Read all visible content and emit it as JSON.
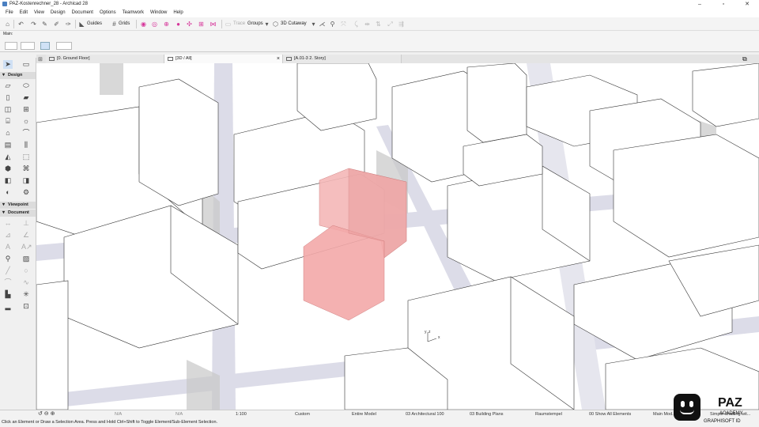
{
  "window": {
    "title": "PAZ-Kostenrechner_28 - Archicad 28"
  },
  "menu": [
    "File",
    "Edit",
    "View",
    "Design",
    "Document",
    "Options",
    "Teamwork",
    "Window",
    "Help"
  ],
  "toolbar": {
    "guides": "Guides",
    "grids": "Grids",
    "trace": "Trace",
    "groups": "Groups",
    "cutaway": "3D Cutaway"
  },
  "infobox": {
    "main_label": "Main:"
  },
  "tabs": [
    {
      "label": "[0. Ground Floor]"
    },
    {
      "label": "[3D / All]"
    },
    {
      "label": "[A.01-3 2. Story]"
    }
  ],
  "toolbox": {
    "design": "Design",
    "viewpoint": "Viewpoint",
    "document": "Document"
  },
  "viewport": {
    "axis_y": "y",
    "axis_z": "z",
    "axis_x": "x"
  },
  "status": {
    "na1": "N/A",
    "na2": "N/A",
    "scale": "1:100",
    "custom": "Custom",
    "model": "Entire Model",
    "layer_combo": "03 Architectural 100",
    "dim": "03 Building Plans",
    "renovation": "Raumstempel",
    "show": "00 Show All Elements",
    "main_model": "Main Mod...",
    "simple": "Simple Shading wit..."
  },
  "hint": "Click an Element or Draw a Selection Area. Press and Hold Ctrl+Shift to Toggle Element/Sub-Element Selection.",
  "brand": {
    "name": "PAZ",
    "sub1": "ACADEMY",
    "sub2": "GRAPHISOFT ID"
  }
}
